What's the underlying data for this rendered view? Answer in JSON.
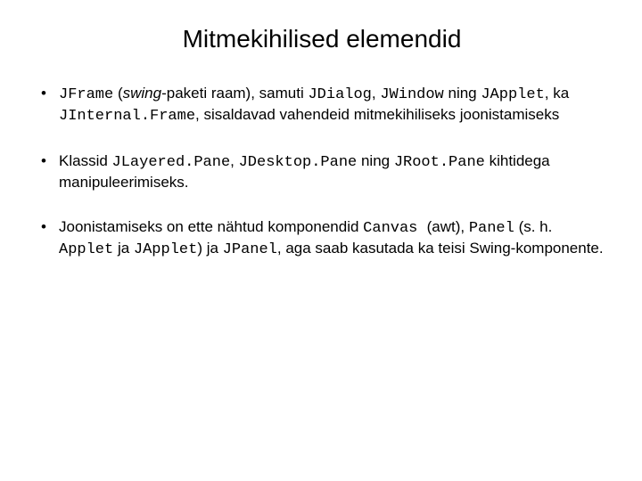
{
  "title": "Mitmekihilised elemendid",
  "b1": {
    "c1": "JFrame",
    "t1": " (",
    "i1": "swing",
    "t2": "-paketi raam), samuti ",
    "c2": "JDialog",
    "t3": ", ",
    "c3": "JWindow",
    "t4": " ning ",
    "c4": "JApplet",
    "t5": ", ka ",
    "c5": "JInternal.Frame",
    "t6": ", sisaldavad vahendeid mitmekihiliseks joonistamiseks"
  },
  "b2": {
    "t1": "Klassid ",
    "c1": "JLayered.Pane",
    "t2": ", ",
    "c2": "JDesktop.Pane",
    "t3": " ning ",
    "c3": "JRoot.Pane",
    "t4": " kihtidega manipuleerimiseks."
  },
  "b3": {
    "t1": "Joonistamiseks on ette nähtud komponendid ",
    "c1": "Canvas ",
    "t2": " (awt), ",
    "c2": "Panel",
    "t3": " (s. h. ",
    "c3": "Applet",
    "t4": " ja ",
    "c4": "JApplet",
    "t5": ") ja ",
    "c5": "JPanel",
    "t6": ", aga saab kasutada ka teisi Swing-komponente."
  }
}
